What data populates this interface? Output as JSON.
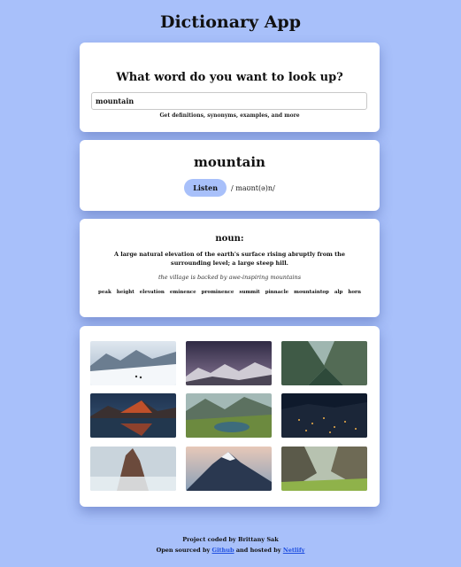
{
  "app": {
    "title": "Dictionary App"
  },
  "search": {
    "heading": "What word do you want to look up?",
    "value": "mountain",
    "hint": "Get definitions, synonyms, examples, and more"
  },
  "word": {
    "title": "mountain",
    "listen_label": "Listen",
    "phonetic": "/ maʊnt(ə)n/"
  },
  "meaning": {
    "part_of_speech": "noun:",
    "definition": "A large natural elevation of the earth's surface rising abruptly from the surrounding level; a large steep hill.",
    "example": "the village is backed by awe-inspiring mountains",
    "synonyms": [
      "peak",
      "height",
      "elevation",
      "eminence",
      "prominence",
      "summit",
      "pinnacle",
      "mountaintop",
      "alp",
      "horn"
    ]
  },
  "images": [
    {
      "icon": "snowy-slope-photo"
    },
    {
      "icon": "purple-peaks-photo"
    },
    {
      "icon": "green-valley-photo"
    },
    {
      "icon": "lake-reflection-photo"
    },
    {
      "icon": "alpine-lake-photo"
    },
    {
      "icon": "night-city-photo"
    },
    {
      "icon": "rock-spire-photo"
    },
    {
      "icon": "dusk-summit-photo"
    },
    {
      "icon": "meadow-cliffs-photo"
    }
  ],
  "footer": {
    "credit": "Project coded by Brittany Sak",
    "open_sourced_prefix": "Open sourced by ",
    "github_label": "Github",
    "hosted_middle": " and hosted by ",
    "netlify_label": "Netlify",
    "link_color": "#1f4fe0"
  },
  "colors": {
    "background": "#a8c0fa",
    "accent": "#a8c0fa"
  }
}
